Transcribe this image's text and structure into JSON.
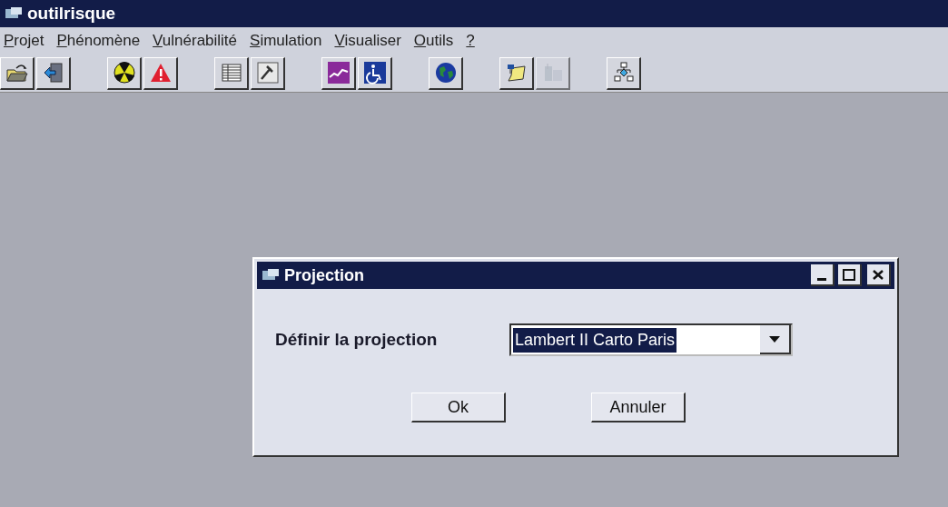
{
  "window": {
    "title": "outilrisque"
  },
  "menu": [
    "Projet",
    "Phénomène",
    "Vulnérabilité",
    "Simulation",
    "Visualiser",
    "Outils",
    "?"
  ],
  "toolbar": [
    [
      {
        "kind": "open",
        "disabled": false
      },
      {
        "kind": "exit",
        "disabled": false
      }
    ],
    [
      {
        "kind": "radiation",
        "disabled": false
      },
      {
        "kind": "warning",
        "disabled": false
      }
    ],
    [
      {
        "kind": "table",
        "disabled": false
      },
      {
        "kind": "tool",
        "disabled": false
      }
    ],
    [
      {
        "kind": "graph",
        "disabled": false
      },
      {
        "kind": "wheelchair",
        "disabled": false
      }
    ],
    [
      {
        "kind": "globe",
        "disabled": false
      }
    ],
    [
      {
        "kind": "map",
        "disabled": false
      },
      {
        "kind": "building",
        "disabled": true
      }
    ],
    [
      {
        "kind": "network",
        "disabled": false
      }
    ]
  ],
  "dialog": {
    "title": "Projection",
    "label": "Définir la projection",
    "projection": {
      "value": "Lambert II Carto Paris",
      "selected": true
    },
    "buttons": [
      "Ok",
      "Annuler"
    ]
  }
}
